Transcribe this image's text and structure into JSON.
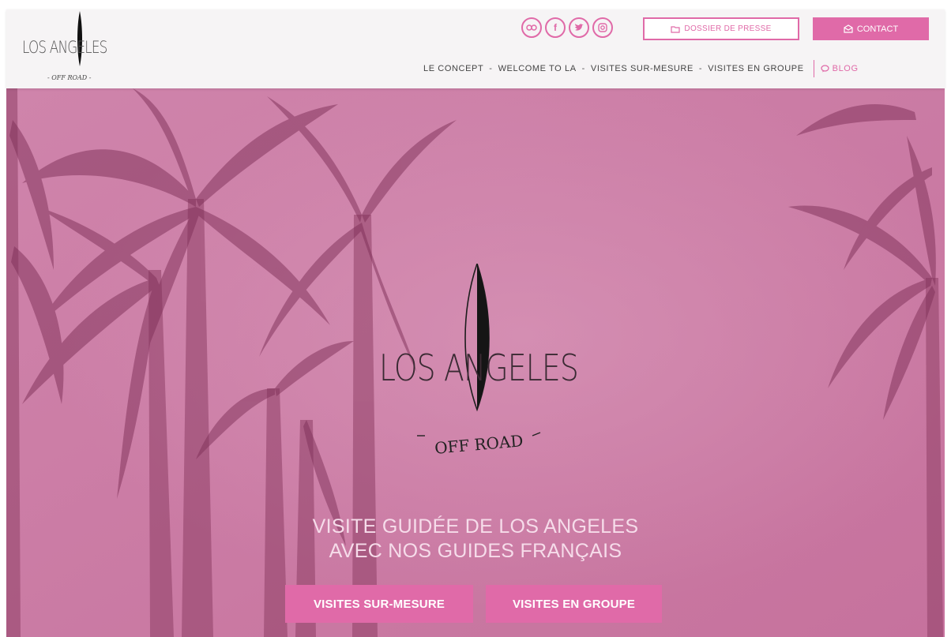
{
  "brand": {
    "wordmark": "LOS ANGELES",
    "subtitle": "OFF ROAD",
    "subtitle_small": "- OFF ROAD -"
  },
  "header": {
    "social_icons": [
      "tripadvisor-icon",
      "facebook-icon",
      "twitter-icon",
      "instagram-icon"
    ],
    "press_label": "DOSSIER DE PRESSE",
    "contact_label": "CONTACT",
    "nav": [
      "LE CONCEPT",
      "WELCOME TO LA",
      "VISITES SUR-MESURE",
      "VISITES EN GROUPE"
    ],
    "blog_label": "BLOG"
  },
  "hero": {
    "headline_line1": "VISITE GUIDÉE DE LOS ANGELES",
    "headline_line2": "AVEC NOS GUIDES FRANÇAIS",
    "cta_custom": "VISITES SUR-MESURE",
    "cta_group": "VISITES EN GROUPE"
  },
  "colors": {
    "accent": "#e06aa8",
    "hero_tint": "#c7779f",
    "header_bg": "#f6f4f5"
  }
}
